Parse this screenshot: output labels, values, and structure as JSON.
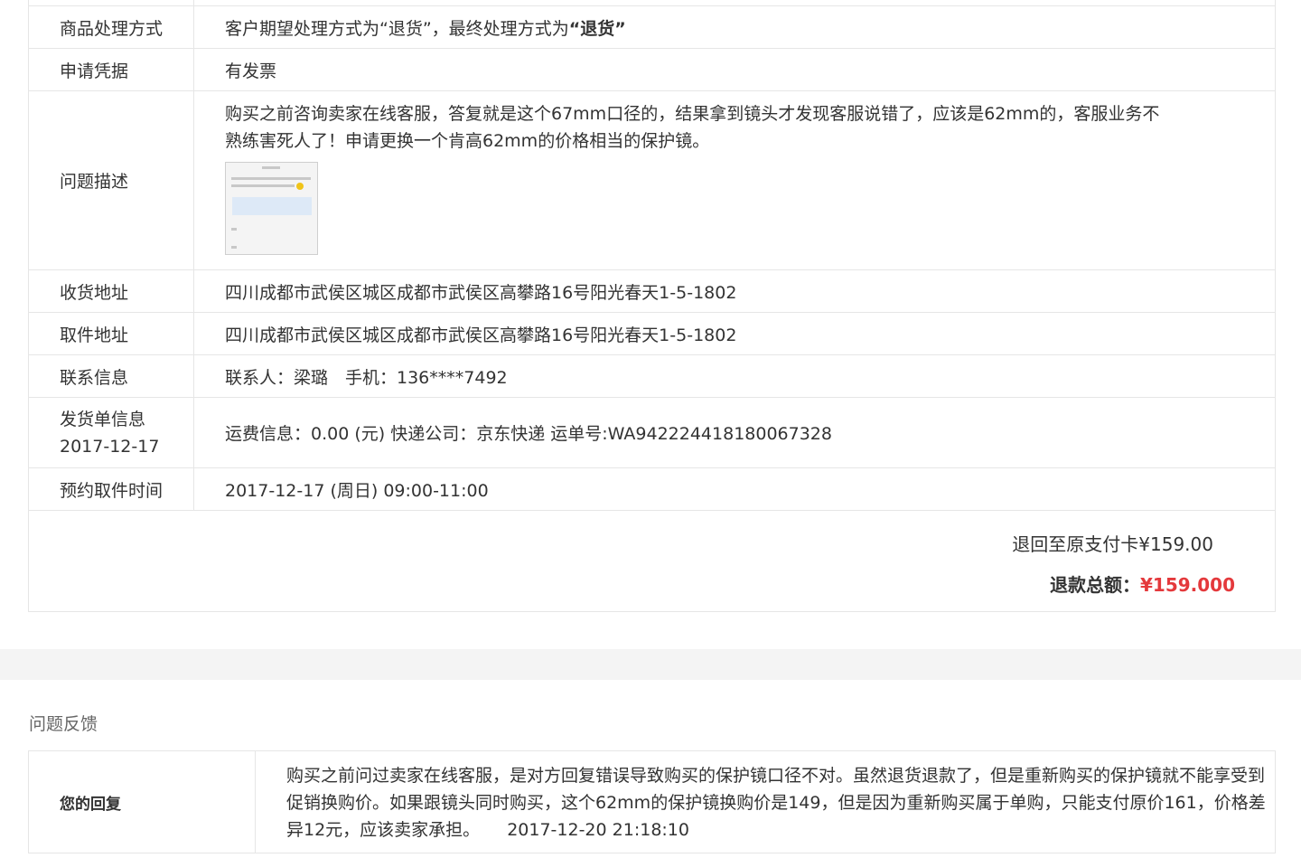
{
  "detail": {
    "handling": {
      "label": "商品处理方式",
      "prefix": "客户期望处理方式为“退货”，最终处理方式为",
      "final": "“退货”"
    },
    "proof": {
      "label": "申请凭据",
      "value": "有发票"
    },
    "description": {
      "label": "问题描述",
      "text": "购买之前咨询卖家在线客服，答复就是这个67mm口径的，结果拿到镜头才发现客服说错了，应该是62mm的，客服业务不熟练害死人了！申请更换一个肯高62mm的价格相当的保护镜。"
    },
    "receive_address": {
      "label": "收货地址",
      "value": "四川成都市武侯区城区成都市武侯区高攀路16号阳光春天1-5-1802"
    },
    "pickup_address": {
      "label": "取件地址",
      "value": "四川成都市武侯区城区成都市武侯区高攀路16号阳光春天1-5-1802"
    },
    "contact": {
      "label": "联系信息",
      "value": "联系人：梁璐　手机：136****7492"
    },
    "shipment": {
      "label": "发货单信息",
      "date": "2017-12-17",
      "value": "运费信息：0.00 (元) 快递公司：京东快递 运单号:WA942224418180067328"
    },
    "pickup_time": {
      "label": "预约取件时间",
      "value": "2017-12-17 (周日) 09:00-11:00"
    },
    "refund_to_card": "退回至原支付卡¥159.00",
    "total_label": "退款总额：",
    "total_amount": "¥159.000"
  },
  "feedback": {
    "title": "问题反馈",
    "reply_label": "您的回复",
    "reply_text": "购买之前问过卖家在线客服，是对方回复错误导致购买的保护镜口径不对。虽然退货退款了，但是重新购买的保护镜就不能享受到促销换购价。如果跟镜头同时购买，这个62mm的保护镜换购价是149，但是因为重新购买属于单购，只能支付原价161，价格差异12元，应该卖家承担。",
    "reply_time": "2017-12-20 21:18:10"
  },
  "colors": {
    "border": "#e6e6e6",
    "accent_red": "#e4393c",
    "band": "#f4f4f4"
  }
}
